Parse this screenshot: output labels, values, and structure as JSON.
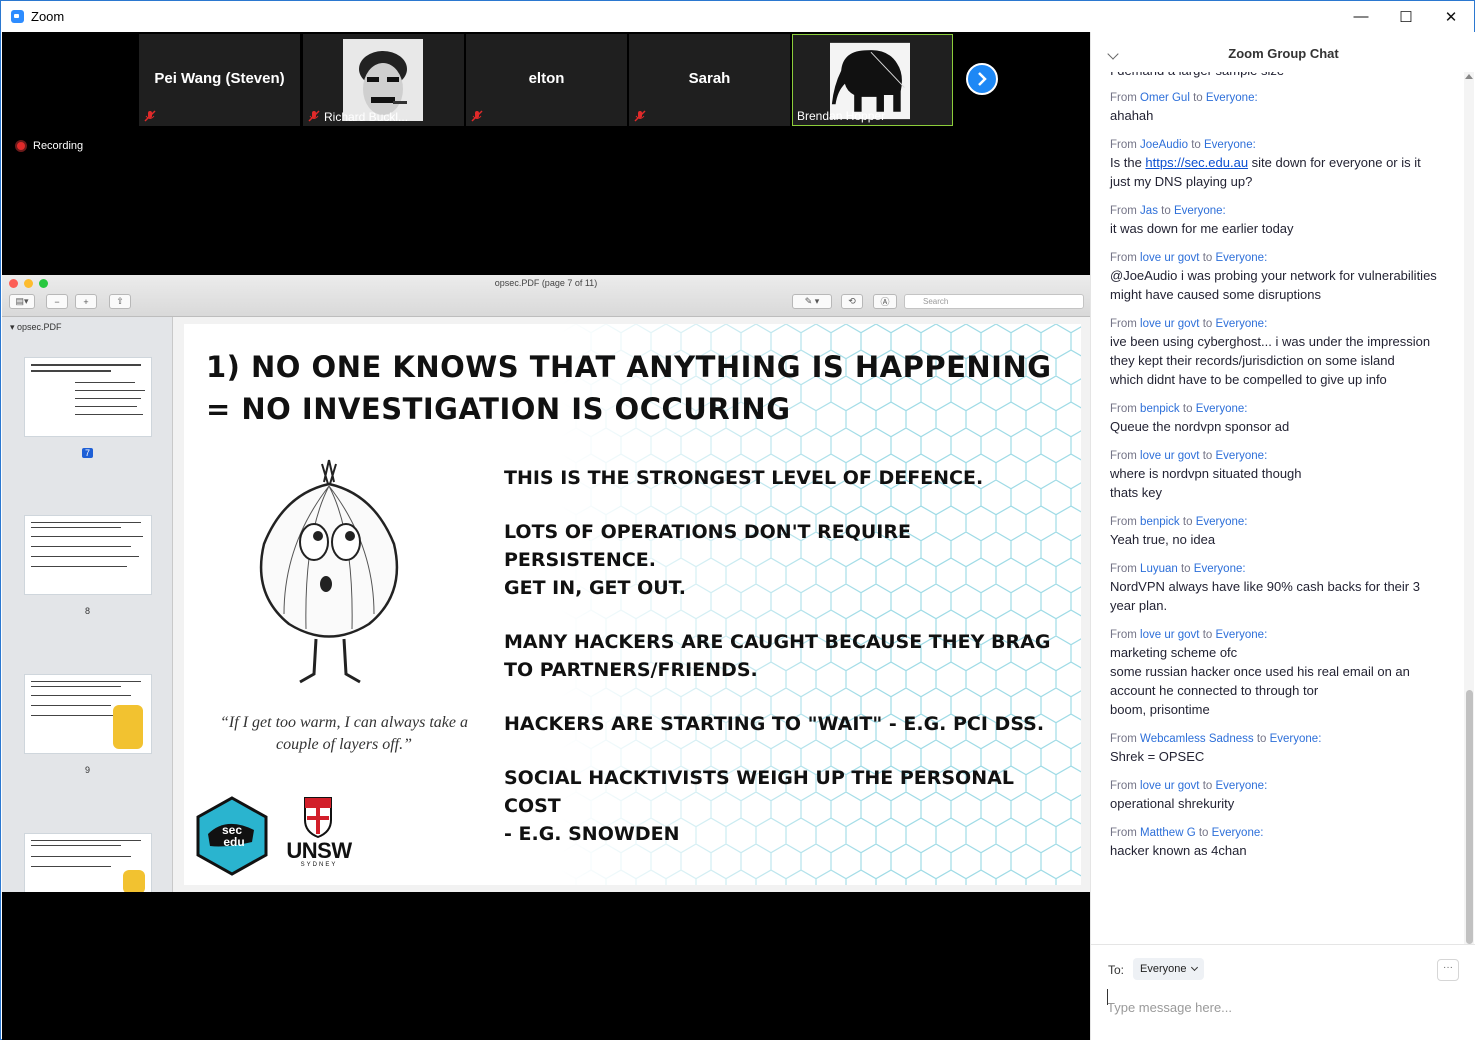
{
  "window": {
    "title": "Zoom",
    "minimize": "—",
    "maximize": "☐",
    "close": "✕"
  },
  "participants": [
    {
      "name": "Pei Wang (Steven)",
      "display": "name",
      "muted": true
    },
    {
      "name": "Richard Buckl...",
      "display": "photo",
      "muted": true
    },
    {
      "name": "elton",
      "display": "name",
      "muted": true
    },
    {
      "name": "Sarah",
      "display": "name",
      "muted": true
    },
    {
      "name": "Brendan Hopper",
      "display": "photo",
      "muted": false,
      "active": true
    }
  ],
  "recording": {
    "label": "Recording"
  },
  "preview": {
    "title": "opsec.PDF (page 7 of 11)",
    "search_placeholder": "Search",
    "sidebar_title": "opsec.PDF",
    "thumbnails": [
      {
        "page": "7",
        "selected": true
      },
      {
        "page": "8",
        "selected": false
      },
      {
        "page": "9",
        "selected": false
      }
    ],
    "slide": {
      "heading_line1": "1) NO ONE KNOWS THAT ANYTHING IS HAPPENING",
      "heading_line2": "= NO INVESTIGATION IS OCCURING",
      "bullets": [
        "THIS IS THE STRONGEST LEVEL OF DEFENCE.",
        "LOTS OF OPERATIONS DON'T REQUIRE PERSISTENCE.\nGET IN, GET OUT.",
        "MANY HACKERS ARE CAUGHT BECAUSE THEY BRAG\nTO PARTNERS/FRIENDS.",
        "HACKERS ARE STARTING TO \"WAIT\" - E.G. PCI DSS.",
        "SOCIAL HACKTIVISTS WEIGH UP THE PERSONAL COST\n- E.G. SNOWDEN"
      ],
      "quote": "“If I get too warm, I can always take a couple of layers off.”",
      "logo_left": "sec edu",
      "logo_right": "UNSW",
      "logo_right_sub": "SYDNEY"
    }
  },
  "chat": {
    "title": "Zoom Group Chat",
    "partial_top": "I demand a larger sample size",
    "from_label": "From",
    "to_label": "to",
    "messages": [
      {
        "from": "Omer Gul",
        "to": "Everyone:",
        "text": "ahahah"
      },
      {
        "from": "JoeAudio",
        "to": "Everyone:",
        "text_before": "Is the ",
        "link": "https://sec.edu.au",
        "text_after": " site down for everyone or is it just my DNS playing up?"
      },
      {
        "from": "Jas",
        "to": "Everyone:",
        "text": "it was down for me earlier today"
      },
      {
        "from": "love ur govt",
        "to": "Everyone:",
        "text": "@JoeAudio i was probing your network for vulnerabilities\nmight have caused some disruptions"
      },
      {
        "from": "love ur govt",
        "to": "Everyone:",
        "text": "ive been using cyberghost... i was under the impression they kept their records/jurisdiction on some island\nwhich didnt have to be compelled to give up info"
      },
      {
        "from": "benpick",
        "to": "Everyone:",
        "text": "Queue the nordvpn sponsor ad"
      },
      {
        "from": "love ur govt",
        "to": "Everyone:",
        "text": "where is nordvpn situated though\nthats key"
      },
      {
        "from": "benpick",
        "to": "Everyone:",
        "text": "Yeah true, no idea"
      },
      {
        "from": "Luyuan",
        "to": "Everyone:",
        "text": "NordVPN always have like 90% cash backs for their 3 year plan."
      },
      {
        "from": "love ur govt",
        "to": "Everyone:",
        "text": "marketing scheme ofc\nsome russian hacker once used his real email on an account he connected to through tor\nboom, prisontime"
      },
      {
        "from": "Webcamless Sadness",
        "to": "Everyone:",
        "text": "Shrek = OPSEC"
      },
      {
        "from": "love ur govt",
        "to": "Everyone:",
        "text": "operational shrekurity"
      },
      {
        "from": "Matthew G",
        "to": "Everyone:",
        "text": "hacker known as 4chan"
      }
    ],
    "footer": {
      "to": "To:",
      "recipient": "Everyone",
      "more": "···",
      "placeholder": "Type message here..."
    }
  }
}
